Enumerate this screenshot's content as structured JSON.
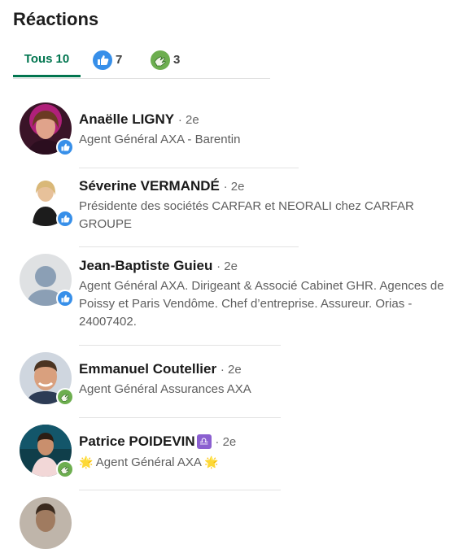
{
  "title": "Réactions",
  "tabs": {
    "all": {
      "label": "Tous",
      "count": "10"
    },
    "like": {
      "icon": "like-reaction-icon",
      "count": "7"
    },
    "support": {
      "icon": "support-reaction-icon",
      "count": "3"
    }
  },
  "people": [
    {
      "name": "Anaëlle LIGNY",
      "degree": "· 2e",
      "headline": "Agent Général AXA - Barentin",
      "reaction": "like"
    },
    {
      "name": "Séverine VERMANDÉ",
      "degree": "· 2e",
      "headline": "Présidente des sociétés CARFAR et NEORALI chez CARFAR GROUPE",
      "reaction": "like"
    },
    {
      "name": "Jean-Baptiste Guieu",
      "degree": "· 2e",
      "headline": "Agent Général AXA. Dirigeant & Associé Cabinet GHR. Agences de Poissy et Paris Vendôme. Chef d’entreprise. Assureur. Orias - 24007402.",
      "reaction": "like"
    },
    {
      "name": "Emmanuel Coutellier",
      "degree": "· 2e",
      "headline": "Agent Général Assurances AXA",
      "reaction": "support"
    },
    {
      "name": "Patrice POIDEVIN",
      "degree": "· 2e",
      "headline": "Agent Général AXA",
      "reaction": "support",
      "name_emoji": "♎",
      "headline_emoji": "🌟"
    }
  ],
  "colors": {
    "accent": "#01754f",
    "like": "#378fe9",
    "support": "#6dae4f"
  }
}
